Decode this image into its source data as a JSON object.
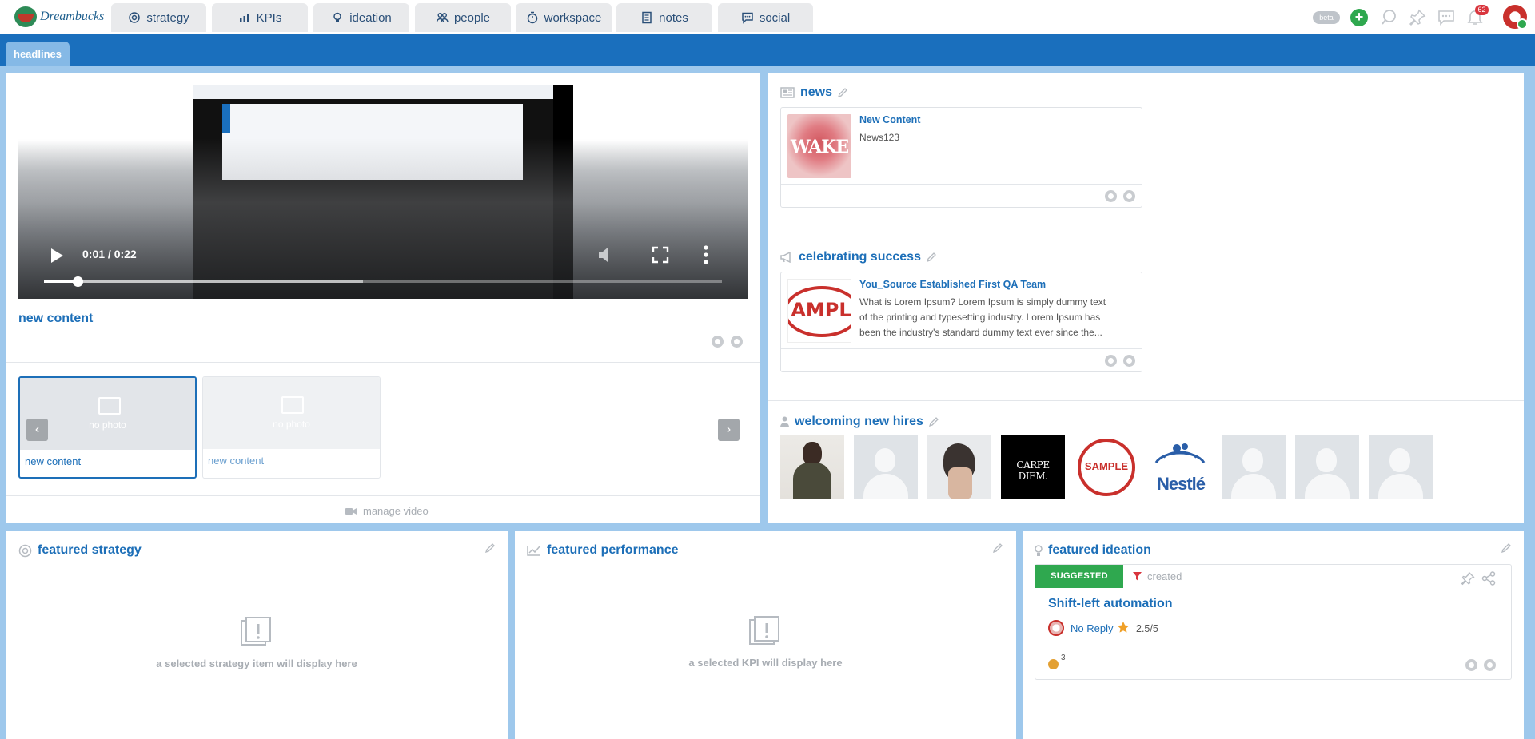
{
  "app": {
    "logo_text": "Dreambucks"
  },
  "nav": {
    "tabs": [
      {
        "label": "strategy",
        "icon": "target-icon"
      },
      {
        "label": "KPIs",
        "icon": "chart-icon"
      },
      {
        "label": "ideation",
        "icon": "lightbulb-icon"
      },
      {
        "label": "people",
        "icon": "people-icon"
      },
      {
        "label": "workspace",
        "icon": "stopwatch-icon"
      },
      {
        "label": "notes",
        "icon": "document-icon"
      },
      {
        "label": "social",
        "icon": "chat-icon"
      }
    ],
    "beta_label": "beta",
    "add_label": "+",
    "notifications_count": "62"
  },
  "headlines_tab": "headlines",
  "video": {
    "time": "0:01 / 0:22",
    "progress": 0.05,
    "buffered": 0.47,
    "title": "new content",
    "thumbs": [
      {
        "placeholder": "no photo",
        "caption": "new content"
      },
      {
        "placeholder": "no photo",
        "caption": "new content"
      }
    ],
    "manage_label": "manage video"
  },
  "news": {
    "title": "news",
    "item": {
      "title": "New Content",
      "body": "News123",
      "thumb_text": "WAKE"
    }
  },
  "success": {
    "title": "celebrating success",
    "item": {
      "title": "You_Source Established First QA Team",
      "body_lines": [
        "What is Lorem Ipsum? Lorem Ipsum is simply dummy text",
        "of the printing and typesetting industry. Lorem Ipsum has",
        "been the industry's standard dummy text ever since the..."
      ],
      "thumb_text": "AMPL"
    }
  },
  "hires": {
    "title": "welcoming new hires",
    "tile_texts": {
      "carpe": "CARPE DIEM.",
      "sample": "SAMPLE",
      "nestle": "Nestlé"
    }
  },
  "strategy": {
    "title": "featured strategy",
    "empty": "a selected strategy item will display here"
  },
  "performance": {
    "title": "featured performance",
    "empty": "a selected KPI will display here"
  },
  "ideation": {
    "title": "featured ideation",
    "status": "SUGGESTED",
    "filter": "created",
    "idea_title": "Shift-left automation",
    "reply": "No Reply",
    "rating": "2.5/5",
    "count": "3"
  },
  "colors": {
    "brand_blue": "#1a6fbd",
    "accent_green": "#2fa84f",
    "link_blue": "#1d6fb8"
  }
}
